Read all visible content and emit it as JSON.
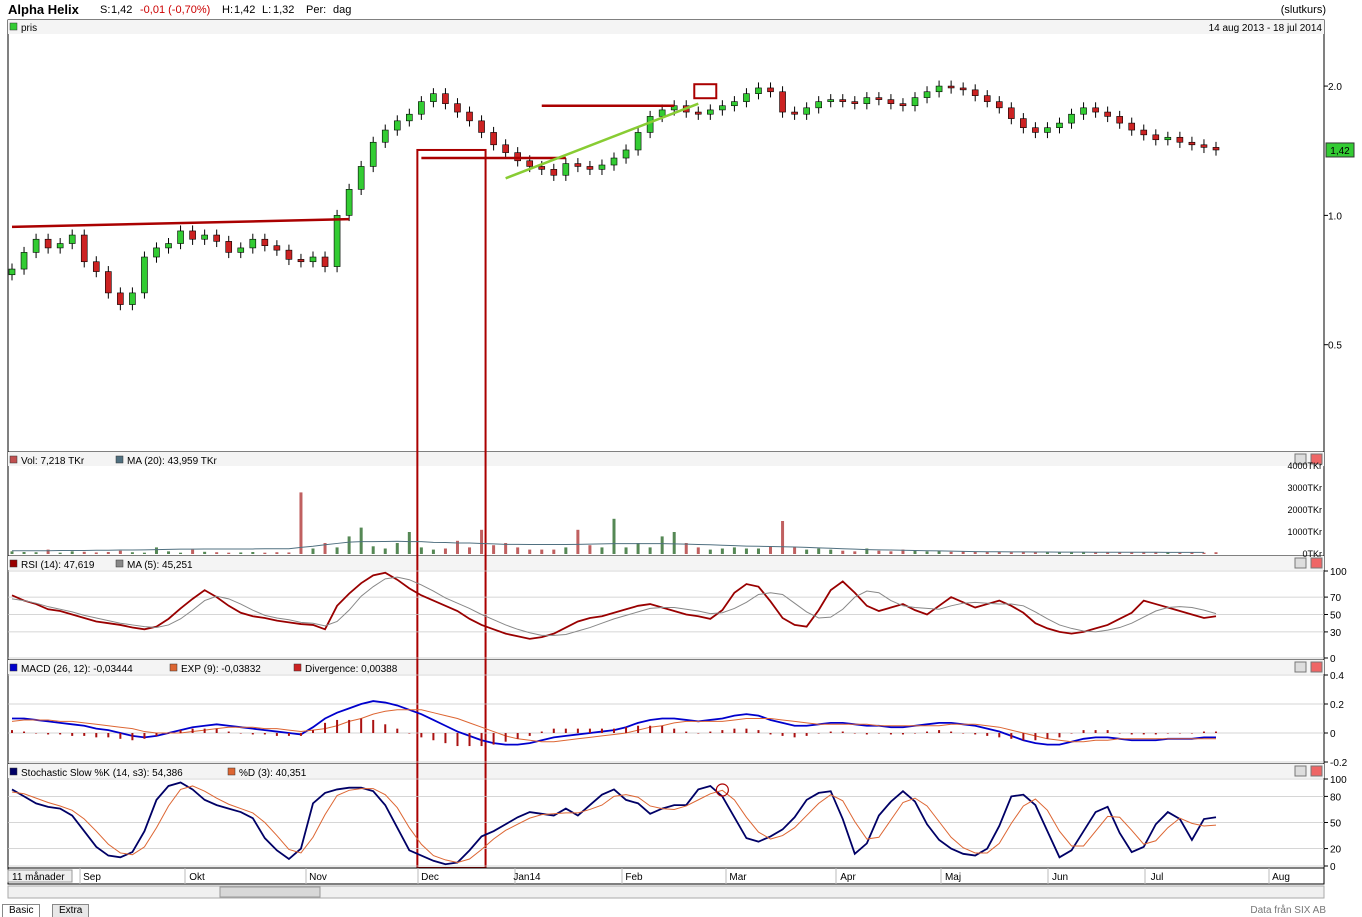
{
  "header": {
    "title": "Alpha Helix",
    "close_label": "S:",
    "close_value": "1,42",
    "change": "-0,01 (-0,70%)",
    "high_label": "H:",
    "high_value": "1,42",
    "low_label": "L:",
    "low_value": "1,32",
    "period_label": "Per:",
    "period_value": "dag",
    "price_type": "(slutkurs)"
  },
  "panels": {
    "price": {
      "legend": "pris",
      "date_range": "14 aug 2013 - 18 jul 2014",
      "last_value_badge": "1,42"
    },
    "volume": {
      "legend_vol": "Vol: 7,218 TKr",
      "legend_ma": "MA (20): 43,959 TKr"
    },
    "rsi": {
      "legend_rsi": "RSI (14): 47,619",
      "legend_ma": "MA (5): 45,251"
    },
    "macd": {
      "legend_macd": "MACD (26, 12): -0,03444",
      "legend_exp": "EXP (9): -0,03832",
      "legend_div": "Divergence: 0,00388"
    },
    "stoch": {
      "legend_k": "Stochastic Slow %K (14, s3): 54,386",
      "legend_d": "%D (3): 40,351"
    }
  },
  "bottom": {
    "range_label": "11 månader",
    "tab_basic": "Basic",
    "tab_extra": "Extra",
    "credit": "Data från SIX AB"
  },
  "colors": {
    "up": "#33cc33",
    "down": "#cc2222",
    "trend_red": "#aa0000",
    "trend_green": "#88cc33",
    "rsi": "#990000",
    "macd": "#0000cc",
    "ma_line": "#888888",
    "signal": "#dd6633"
  },
  "chart_data": [
    {
      "type": "candlestick",
      "title": "pris",
      "x_range": [
        "14 aug 2013",
        "18 jul 2014"
      ],
      "x_ticks": [
        "Sep",
        "Okt",
        "Nov",
        "Dec",
        "Jan14",
        "Feb",
        "Mar",
        "Apr",
        "Maj",
        "Jun",
        "Jul",
        "Aug"
      ],
      "y_ticks": [
        "2.0",
        "1.0",
        "0.5"
      ],
      "ylim": [
        0.3,
        2.3
      ],
      "close_series": [
        0.75,
        0.82,
        0.88,
        0.84,
        0.86,
        0.9,
        0.78,
        0.74,
        0.66,
        0.62,
        0.66,
        0.8,
        0.84,
        0.86,
        0.92,
        0.88,
        0.9,
        0.87,
        0.82,
        0.84,
        0.88,
        0.85,
        0.83,
        0.79,
        0.78,
        0.8,
        0.76,
        1.0,
        1.15,
        1.3,
        1.48,
        1.58,
        1.66,
        1.72,
        1.84,
        1.92,
        1.82,
        1.74,
        1.66,
        1.56,
        1.46,
        1.4,
        1.34,
        1.3,
        1.28,
        1.24,
        1.32,
        1.3,
        1.28,
        1.31,
        1.36,
        1.42,
        1.56,
        1.7,
        1.76,
        1.8,
        1.74,
        1.72,
        1.76,
        1.8,
        1.84,
        1.92,
        1.98,
        1.94,
        1.74,
        1.72,
        1.78,
        1.84,
        1.86,
        1.84,
        1.82,
        1.88,
        1.86,
        1.82,
        1.8,
        1.88,
        1.94,
        2.0,
        1.98,
        1.96,
        1.9,
        1.84,
        1.78,
        1.68,
        1.6,
        1.56,
        1.6,
        1.64,
        1.72,
        1.78,
        1.74,
        1.7,
        1.64,
        1.58,
        1.54,
        1.5,
        1.52,
        1.48,
        1.46,
        1.44,
        1.42
      ]
    },
    {
      "type": "bar",
      "title": "Vol",
      "y_ticks": [
        "4000TKr",
        "3000TKr",
        "2000TKr",
        "1000TKr",
        "0TKr"
      ],
      "ylim": [
        0,
        4000
      ],
      "values": [
        120,
        90,
        80,
        200,
        60,
        120,
        100,
        70,
        90,
        150,
        80,
        60,
        300,
        120,
        60,
        200,
        100,
        80,
        60,
        70,
        90,
        60,
        80,
        70,
        2800,
        250,
        500,
        300,
        800,
        1200,
        350,
        250,
        500,
        1000,
        300,
        200,
        250,
        600,
        300,
        1100,
        400,
        500,
        300,
        200,
        200,
        200,
        300,
        1100,
        400,
        300,
        1600,
        300,
        500,
        300,
        800,
        1000,
        500,
        300,
        200,
        250,
        300,
        250,
        250,
        350,
        1500,
        300,
        200,
        250,
        200,
        150,
        120,
        250,
        150,
        120,
        200,
        150,
        120,
        150,
        100,
        120,
        100,
        100,
        100,
        80,
        100,
        100,
        80,
        90,
        80,
        70,
        80,
        80,
        70,
        90,
        80,
        70,
        80,
        60,
        90,
        60,
        80,
        60,
        70
      ],
      "ma_values": [
        150,
        150,
        150,
        150,
        160,
        160,
        160,
        170,
        170,
        180,
        180,
        190,
        200,
        210,
        220,
        220,
        230,
        230,
        230,
        230,
        230,
        240,
        240,
        240,
        300,
        350,
        420,
        480,
        540,
        560,
        560,
        570,
        580,
        560,
        560,
        530,
        520,
        500,
        500,
        480,
        460,
        440,
        440,
        430,
        430,
        430,
        430,
        440,
        450,
        460,
        470,
        470,
        470,
        470,
        470,
        460,
        450,
        430,
        420,
        400,
        380,
        360,
        350,
        340,
        330,
        320,
        300,
        280,
        260,
        240,
        220,
        200,
        190,
        180,
        170,
        160,
        150,
        140,
        130,
        120,
        110,
        100,
        100,
        95,
        95,
        90,
        90,
        85,
        85,
        85,
        80,
        80,
        80,
        80,
        80,
        80,
        75,
        75,
        75,
        75
      ]
    },
    {
      "type": "line",
      "title": "RSI",
      "y_ticks": [
        "100",
        "70",
        "50",
        "30",
        "0"
      ],
      "ylim": [
        0,
        100
      ],
      "series": [
        {
          "name": "RSI (14)",
          "values": [
            72,
            66,
            62,
            56,
            54,
            50,
            46,
            42,
            40,
            38,
            35,
            33,
            36,
            45,
            57,
            68,
            78,
            70,
            60,
            52,
            48,
            46,
            43,
            41,
            39,
            38,
            33,
            60,
            74,
            86,
            95,
            98,
            90,
            80,
            72,
            66,
            60,
            54,
            45,
            38,
            33,
            28,
            25,
            22,
            24,
            28,
            35,
            42,
            46,
            48,
            52,
            56,
            60,
            62,
            58,
            54,
            50,
            48,
            45,
            55,
            75,
            85,
            82,
            65,
            46,
            38,
            36,
            55,
            78,
            88,
            75,
            60,
            54,
            58,
            62,
            55,
            50,
            60,
            70,
            64,
            58,
            62,
            66,
            60,
            52,
            40,
            34,
            30,
            28,
            30,
            34,
            38,
            45,
            52,
            66,
            62,
            58,
            54,
            50,
            46,
            48
          ]
        },
        {
          "name": "MA (5)",
          "values": [
            68,
            66,
            63,
            59,
            56,
            53,
            49,
            46,
            43,
            40,
            38,
            36,
            35,
            38,
            45,
            55,
            66,
            71,
            68,
            62,
            55,
            49,
            46,
            44,
            41,
            40,
            37,
            42,
            55,
            71,
            82,
            91,
            93,
            90,
            84,
            77,
            69,
            63,
            57,
            50,
            44,
            38,
            33,
            29,
            26,
            26,
            27,
            31,
            35,
            40,
            45,
            49,
            53,
            57,
            58,
            58,
            56,
            54,
            51,
            52,
            57,
            64,
            73,
            75,
            73,
            63,
            53,
            46,
            47,
            56,
            70,
            77,
            75,
            66,
            60,
            58,
            57,
            56,
            60,
            63,
            64,
            63,
            62,
            62,
            60,
            53,
            45,
            38,
            34,
            31,
            30,
            32,
            35,
            40,
            47,
            54,
            58,
            59,
            58,
            55,
            51
          ]
        }
      ]
    },
    {
      "type": "line",
      "title": "MACD",
      "y_ticks": [
        "0.4",
        "0.2",
        "0",
        "-0.2"
      ],
      "ylim": [
        -0.2,
        0.4
      ],
      "series": [
        {
          "name": "MACD (26, 12)",
          "values": [
            0.1,
            0.1,
            0.09,
            0.08,
            0.07,
            0.06,
            0.05,
            0.03,
            0.02,
            0.0,
            -0.02,
            -0.03,
            -0.02,
            0.0,
            0.02,
            0.04,
            0.05,
            0.06,
            0.05,
            0.04,
            0.03,
            0.02,
            0.01,
            0.0,
            -0.01,
            0.04,
            0.1,
            0.14,
            0.17,
            0.2,
            0.22,
            0.21,
            0.19,
            0.16,
            0.13,
            0.09,
            0.05,
            0.01,
            -0.02,
            -0.05,
            -0.07,
            -0.08,
            -0.08,
            -0.07,
            -0.05,
            -0.03,
            -0.02,
            -0.01,
            0.0,
            0.01,
            0.02,
            0.04,
            0.07,
            0.09,
            0.1,
            0.1,
            0.09,
            0.08,
            0.09,
            0.1,
            0.12,
            0.13,
            0.12,
            0.09,
            0.07,
            0.05,
            0.05,
            0.06,
            0.07,
            0.07,
            0.06,
            0.05,
            0.05,
            0.04,
            0.04,
            0.05,
            0.06,
            0.07,
            0.07,
            0.06,
            0.05,
            0.03,
            0.01,
            -0.02,
            -0.05,
            -0.07,
            -0.08,
            -0.08,
            -0.06,
            -0.04,
            -0.03,
            -0.03,
            -0.04,
            -0.05,
            -0.05,
            -0.05,
            -0.04,
            -0.04,
            -0.04,
            -0.03,
            -0.03
          ]
        },
        {
          "name": "EXP (9)",
          "values": [
            0.08,
            0.09,
            0.09,
            0.09,
            0.08,
            0.08,
            0.07,
            0.06,
            0.05,
            0.04,
            0.03,
            0.01,
            0.0,
            0.0,
            0.0,
            0.01,
            0.02,
            0.03,
            0.04,
            0.04,
            0.04,
            0.03,
            0.03,
            0.02,
            0.01,
            0.02,
            0.03,
            0.05,
            0.08,
            0.1,
            0.13,
            0.15,
            0.16,
            0.16,
            0.16,
            0.14,
            0.12,
            0.1,
            0.07,
            0.04,
            0.01,
            -0.02,
            -0.04,
            -0.05,
            -0.06,
            -0.06,
            -0.05,
            -0.04,
            -0.03,
            -0.02,
            -0.01,
            0.0,
            0.02,
            0.04,
            0.05,
            0.07,
            0.08,
            0.08,
            0.08,
            0.08,
            0.09,
            0.1,
            0.1,
            0.1,
            0.09,
            0.08,
            0.07,
            0.06,
            0.06,
            0.06,
            0.06,
            0.06,
            0.05,
            0.05,
            0.05,
            0.05,
            0.05,
            0.05,
            0.06,
            0.06,
            0.06,
            0.05,
            0.04,
            0.02,
            0.0,
            -0.02,
            -0.04,
            -0.05,
            -0.06,
            -0.06,
            -0.05,
            -0.05,
            -0.04,
            -0.04,
            -0.04,
            -0.04,
            -0.04,
            -0.04,
            -0.04,
            -0.04,
            -0.04
          ]
        }
      ]
    },
    {
      "type": "line",
      "title": "Stochastic Slow",
      "y_ticks": [
        "100",
        "80",
        "50",
        "20",
        "0"
      ],
      "ylim": [
        0,
        100
      ],
      "series": [
        {
          "name": "%K (14, s3)",
          "values": [
            88,
            80,
            72,
            68,
            66,
            58,
            40,
            22,
            12,
            10,
            16,
            40,
            76,
            92,
            96,
            88,
            76,
            70,
            66,
            62,
            55,
            32,
            18,
            8,
            20,
            72,
            84,
            88,
            90,
            90,
            86,
            70,
            44,
            18,
            12,
            6,
            2,
            4,
            18,
            34,
            40,
            48,
            56,
            62,
            60,
            58,
            66,
            58,
            70,
            82,
            88,
            76,
            72,
            60,
            66,
            70,
            70,
            88,
            92,
            80,
            56,
            32,
            28,
            34,
            42,
            56,
            76,
            84,
            86,
            54,
            14,
            26,
            58,
            74,
            86,
            74,
            48,
            30,
            20,
            14,
            12,
            20,
            46,
            80,
            82,
            70,
            40,
            10,
            18,
            40,
            62,
            68,
            38,
            16,
            22,
            48,
            62,
            54,
            30,
            54,
            56
          ]
        },
        {
          "name": "%D (3)",
          "values": [
            85,
            83,
            78,
            73,
            69,
            64,
            54,
            40,
            25,
            15,
            13,
            22,
            44,
            69,
            88,
            92,
            86,
            78,
            71,
            66,
            61,
            50,
            35,
            19,
            15,
            33,
            59,
            81,
            87,
            89,
            89,
            82,
            67,
            44,
            25,
            12,
            7,
            4,
            8,
            19,
            31,
            41,
            48,
            55,
            59,
            60,
            61,
            61,
            65,
            70,
            80,
            82,
            79,
            69,
            66,
            65,
            69,
            76,
            83,
            87,
            76,
            56,
            39,
            31,
            35,
            44,
            58,
            72,
            82,
            75,
            51,
            31,
            33,
            53,
            73,
            78,
            69,
            51,
            33,
            21,
            15,
            15,
            26,
            49,
            69,
            77,
            64,
            40,
            23,
            23,
            40,
            57,
            56,
            41,
            25,
            29,
            44,
            55,
            49,
            46,
            47
          ]
        }
      ]
    }
  ]
}
